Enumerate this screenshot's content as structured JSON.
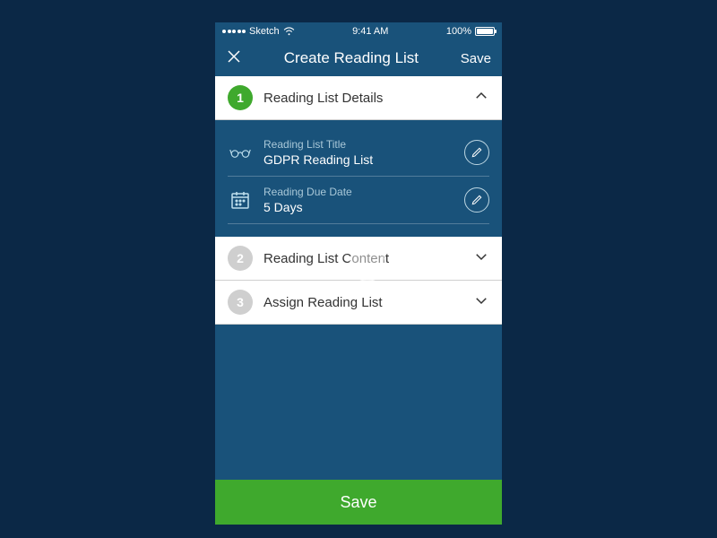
{
  "status_bar": {
    "carrier": "Sketch",
    "time": "9:41 AM",
    "battery_pct": "100%"
  },
  "header": {
    "title": "Create Reading List",
    "save_label": "Save"
  },
  "steps": {
    "s1": {
      "num": "1",
      "label": "Reading List Details"
    },
    "s2": {
      "num": "2",
      "label": "Reading List Content"
    },
    "s3": {
      "num": "3",
      "label": "Assign Reading List"
    }
  },
  "details": {
    "title_label": "Reading List Title",
    "title_value": "GDPR Reading List",
    "due_label": "Reading Due Date",
    "due_value": "5 Days"
  },
  "bottom": {
    "save_label": "Save"
  }
}
